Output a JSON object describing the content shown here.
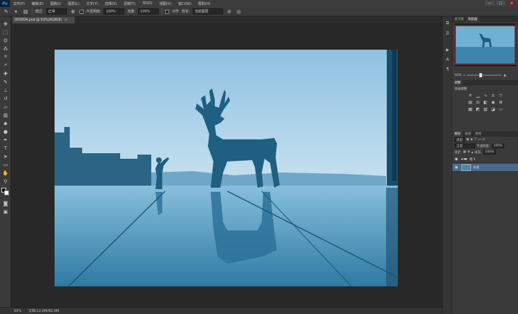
{
  "app": {
    "logo": "Ps"
  },
  "menu": [
    "文件(F)",
    "编辑(E)",
    "图像(I)",
    "图层(L)",
    "文字(Y)",
    "选择(S)",
    "滤镜(T)",
    "3D(D)",
    "视图(V)",
    "窗口(W)",
    "帮助(H)"
  ],
  "window_controls": {
    "minimize": "—",
    "maximize": "□",
    "close": "×"
  },
  "options": {
    "mode_label": "模式:",
    "mode_value": "正常",
    "opacity_label": "不透明度:",
    "opacity_value": "100%",
    "flow_label": "流量:",
    "flow_value": "100%",
    "align_label": "对齐",
    "sample_label": "样本:",
    "sample_value": "当前图层"
  },
  "document": {
    "tab_title": "000004.psd @ 50%(RGB/8)",
    "tab_close": "×"
  },
  "status": {
    "zoom": "50%",
    "doc_size": "文档:12.0M/92.0M"
  },
  "panels": {
    "navigator_tabs": [
      "直方图",
      "导航器"
    ],
    "navigator_zoom": "50%",
    "adjust_tabs": [
      "调整"
    ],
    "adjust_title": "添加调整",
    "layers_tabs": [
      "图层",
      "通道",
      "路径"
    ],
    "layers_kind": "类型",
    "blend_mode": "正常",
    "opacity_label": "不透明度:",
    "opacity_value": "100%",
    "lock_label": "锁定:",
    "fill_label": "填充:",
    "fill_value": "100%",
    "layers": [
      {
        "name": "组 1",
        "type": "group"
      },
      {
        "name": "背景",
        "type": "image",
        "active": true
      }
    ]
  },
  "colors": {
    "accent": "#31a8ff",
    "photo_sky": "#9bc7e4",
    "photo_dark": "#1b4e6c",
    "layer_selected": "#4a6a8a"
  }
}
